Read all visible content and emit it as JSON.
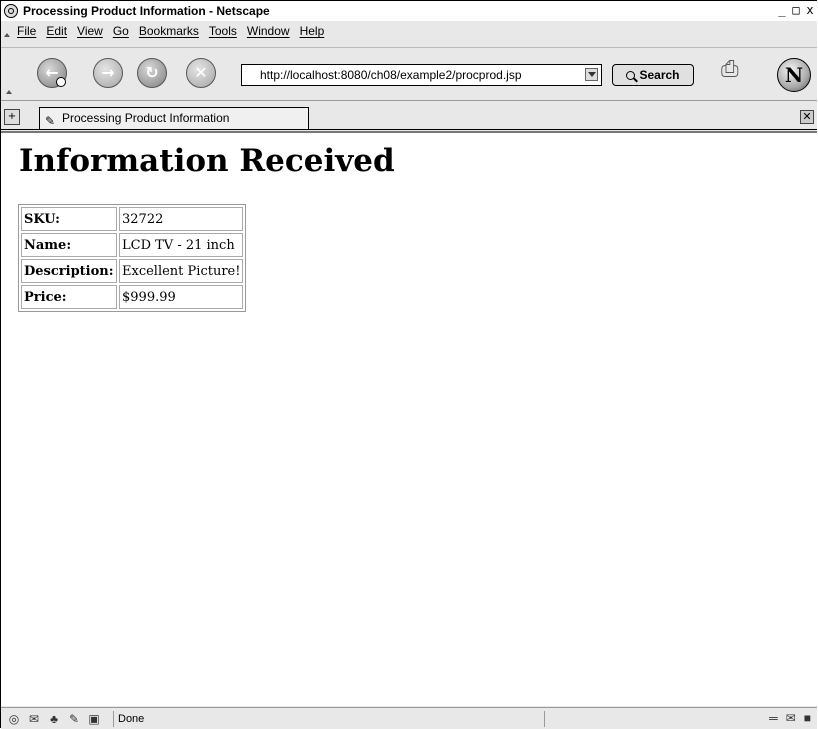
{
  "window": {
    "title": "Processing Product Information - Netscape",
    "controls": [
      "_",
      "□",
      "x"
    ]
  },
  "menu": [
    "File",
    "Edit",
    "View",
    "Go",
    "Bookmarks",
    "Tools",
    "Window",
    "Help"
  ],
  "toolbar": {
    "url": "http://localhost:8080/ch08/example2/procprod.jsp",
    "search_label": "Search"
  },
  "tab": {
    "title": "Processing Product Information"
  },
  "page": {
    "heading": "Information Received",
    "rows": [
      {
        "label": "SKU:",
        "value": "32722"
      },
      {
        "label": "Name:",
        "value": "LCD TV - 21 inch"
      },
      {
        "label": "Description:",
        "value": "Excellent Picture!"
      },
      {
        "label": "Price:",
        "value": "$999.99"
      }
    ]
  },
  "status": {
    "text": "Done"
  }
}
